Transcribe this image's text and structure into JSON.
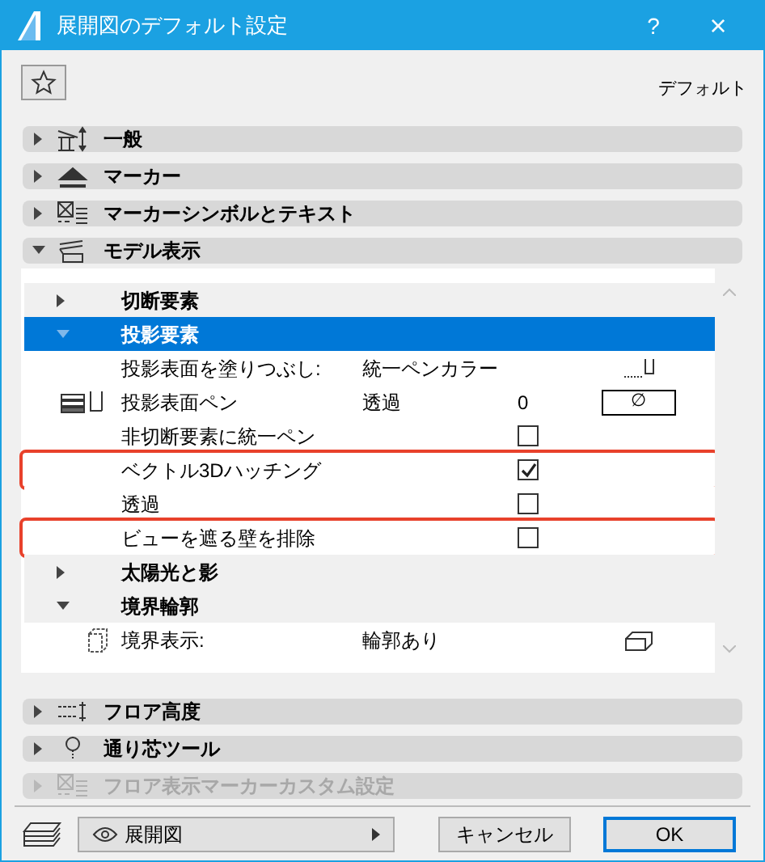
{
  "window": {
    "title": "展開図のデフォルト設定",
    "help": "?",
    "close": "×"
  },
  "header": {
    "preset": "デフォルト"
  },
  "sections_top": [
    {
      "label": "一般",
      "expanded": false,
      "disabled": false
    },
    {
      "label": "マーカー",
      "expanded": false,
      "disabled": false
    },
    {
      "label": "マーカーシンボルとテキスト",
      "expanded": false,
      "disabled": false
    },
    {
      "label": "モデル表示",
      "expanded": true,
      "disabled": false
    }
  ],
  "panel_rows": [
    {
      "kind": "group",
      "label": "切断要素",
      "expanded": false,
      "selected": false
    },
    {
      "kind": "group",
      "label": "投影要素",
      "expanded": true,
      "selected": true
    },
    {
      "kind": "field",
      "label": "投影表面を塗りつぶし:",
      "value": "統一ペンカラー"
    },
    {
      "kind": "field",
      "label": "投影表面ペン",
      "value": "透過",
      "number": "0",
      "box": "∅"
    },
    {
      "kind": "checkbox",
      "label": "非切断要素に統一ペン",
      "checked": false,
      "highlighted": false
    },
    {
      "kind": "checkbox",
      "label": "ベクトル3Dハッチング",
      "checked": true,
      "highlighted": true
    },
    {
      "kind": "checkbox",
      "label": "透過",
      "checked": false,
      "highlighted": false
    },
    {
      "kind": "checkbox",
      "label": "ビューを遮る壁を排除",
      "checked": false,
      "highlighted": true
    },
    {
      "kind": "group",
      "label": "太陽光と影",
      "expanded": false,
      "selected": false
    },
    {
      "kind": "group",
      "label": "境界輪郭",
      "expanded": true,
      "selected": false
    },
    {
      "kind": "field",
      "label": "境界表示:",
      "value": "輪郭あり"
    }
  ],
  "sections_bottom": [
    {
      "label": "フロア高度",
      "expanded": false,
      "disabled": false
    },
    {
      "label": "通り芯ツール",
      "expanded": false,
      "disabled": false
    },
    {
      "label": "フロア表示マーカーカスタム設定",
      "expanded": false,
      "disabled": true
    }
  ],
  "footer": {
    "view": "展開図",
    "cancel": "キャンセル",
    "ok": "OK"
  }
}
